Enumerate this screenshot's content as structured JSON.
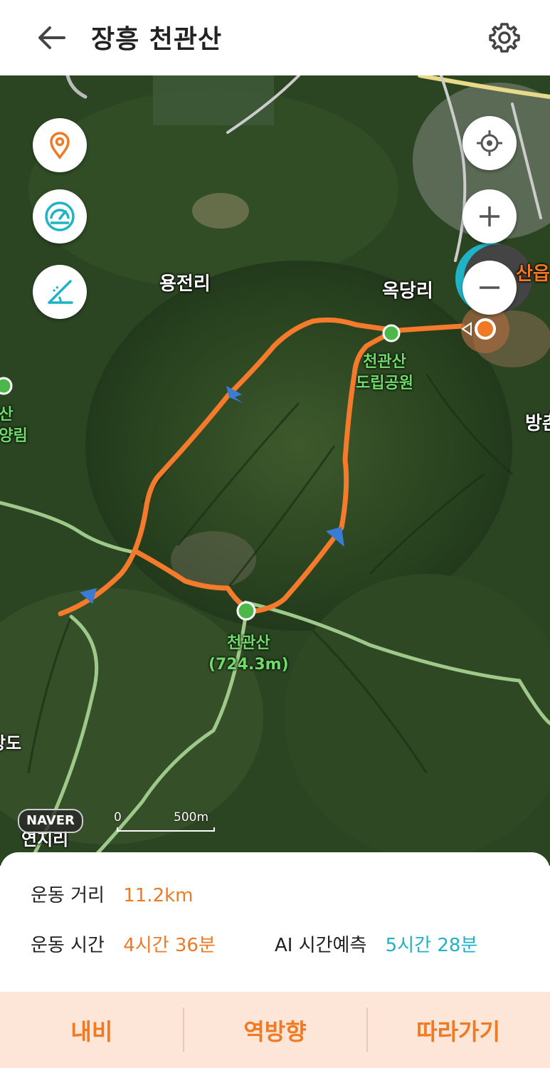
{
  "header": {
    "title": "장흥 천관산",
    "back_icon": "arrow-left-icon",
    "settings_icon": "gear-icon"
  },
  "map": {
    "labels": {
      "yongjeon": "용전리",
      "okdang": "옥당리",
      "park": "천관산\n도립공원",
      "peak": "천관산\n(724.3m)",
      "left_forest": "관산\n휴양림",
      "bang": "방촌",
      "san": "산읍",
      "leftdo": "상도",
      "yeonji": "연지리"
    },
    "naver": "NAVER",
    "scale": {
      "zero": "0",
      "dist": "500m"
    },
    "route_color": "#f57a2c"
  },
  "stats": {
    "distance_label": "운동 거리",
    "distance_value": "11.2km",
    "time_label": "운동 시간",
    "time_value": "4시간 36분",
    "ai_label": "AI 시간예측",
    "ai_value": "5시간 28분"
  },
  "actions": {
    "navi": "내비",
    "reverse": "역방향",
    "follow": "따라가기"
  },
  "colors": {
    "accent": "#f07a24",
    "ai": "#1fb3c6"
  }
}
